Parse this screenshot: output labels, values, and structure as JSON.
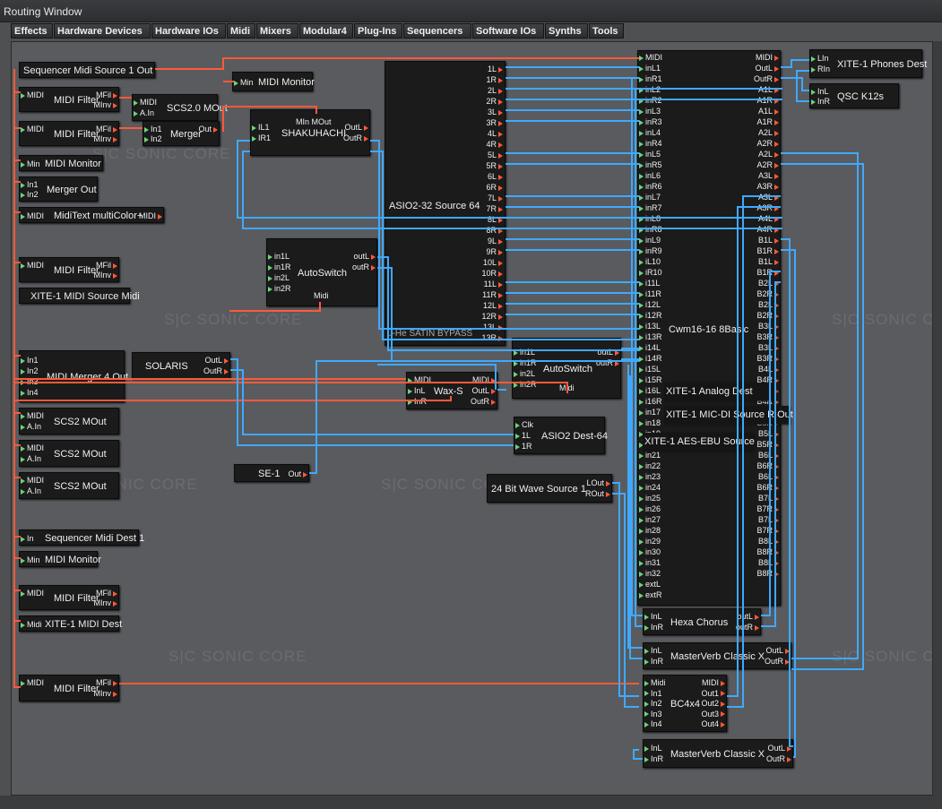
{
  "window_title": "Routing Window",
  "watermark": "SONIC CORE",
  "watermark_logo": "S|C",
  "tabs": [
    "Effects",
    "Hardware Devices",
    "Hardware IOs",
    "Midi",
    "Mixers",
    "Modular4",
    "Plug-Ins",
    "Sequencers",
    "Software IOs",
    "Synths",
    "Tools"
  ],
  "colors": {
    "midi_wire": "#ff5a38",
    "audio_wire": "#3fa9ff",
    "input_port": "#6ad47a",
    "output_port": "#ff5a38",
    "canvas": "#595b5f",
    "module": "#1b1b1b"
  },
  "modules": {
    "seq_src": {
      "name": "Sequencer Midi Source 1 Out"
    },
    "filter1": {
      "name": "MIDI Filter",
      "ins": [
        "MIDI"
      ],
      "outs": [
        "MFil",
        "MInv"
      ]
    },
    "filter2": {
      "name": "MIDI Filter",
      "ins": [
        "MIDI"
      ],
      "outs": [
        "MFil",
        "MInv"
      ]
    },
    "scs1": {
      "name": "SCS2.0 MOut",
      "ins": [
        "MIDI",
        "A.In"
      ]
    },
    "merger1": {
      "name": "Merger",
      "ins": [
        "In1",
        "In2"
      ],
      "outs": [
        "Out"
      ]
    },
    "mon1": {
      "name": "MIDI Monitor",
      "ins": [
        "Min"
      ]
    },
    "merger2": {
      "name": "Merger Out",
      "ins": [
        "In1",
        "In2"
      ]
    },
    "miditext": {
      "name": "MidiText multiColor+",
      "ins": [
        "MIDI"
      ],
      "outs": [
        "MIDI"
      ]
    },
    "filter3": {
      "name": "MIDI Filter",
      "ins": [
        "MIDI"
      ],
      "outs": [
        "MFil",
        "MInv"
      ]
    },
    "xite_src": {
      "name": "XITE-1 MIDI Source Midi"
    },
    "merger4": {
      "name": "MIDI Merger 4 Out",
      "ins": [
        "In1",
        "In2",
        "In3",
        "In4"
      ]
    },
    "scs2": {
      "name": "SCS2 MOut",
      "ins": [
        "MIDI",
        "A.In"
      ]
    },
    "scs3": {
      "name": "SCS2 MOut",
      "ins": [
        "MIDI",
        "A.In"
      ]
    },
    "scs4": {
      "name": "SCS2 MOut",
      "ins": [
        "MIDI",
        "A.In"
      ]
    },
    "seq_dest": {
      "name": "Sequencer Midi Dest 1",
      "ins": [
        "In"
      ]
    },
    "mon3": {
      "name": "MIDI Monitor",
      "ins": [
        "Min"
      ]
    },
    "filter4": {
      "name": "MIDI Filter",
      "ins": [
        "MIDI"
      ],
      "outs": [
        "MFil",
        "MInv"
      ]
    },
    "xite_dest": {
      "name": "XITE-1 MIDI Dest",
      "ins": [
        "Midi"
      ]
    },
    "filter5": {
      "name": "MIDI Filter",
      "ins": [
        "MIDI"
      ],
      "outs": [
        "MFil",
        "MInv"
      ]
    },
    "mon2": {
      "name": "MIDI Monitor",
      "ins": [
        "Min"
      ]
    },
    "shaku": {
      "name": "SHAKUHACHI",
      "ins": [
        "IL1",
        "IR1"
      ],
      "outs": [
        "OutL",
        "OutR"
      ],
      "top": "MIn MOut"
    },
    "autosw1": {
      "name": "AutoSwitch",
      "ins": [
        "in1L",
        "in1R",
        "in2L",
        "in2R"
      ],
      "outs": [
        "outL",
        "outR"
      ],
      "bottom": "Midi"
    },
    "solaris": {
      "name": "SOLARIS",
      "outs": [
        "OutL",
        "OutR"
      ]
    },
    "se1": {
      "name": "SE-1",
      "outs": [
        "Out"
      ]
    },
    "asio_src": {
      "name": "ASIO2-32 Source 64",
      "outs": [
        "1L",
        "1R",
        "2L",
        "2R",
        "3L",
        "3R",
        "4L",
        "4R",
        "5L",
        "5R",
        "6L",
        "6R",
        "7L",
        "7R",
        "8L",
        "8R",
        "9L",
        "9R",
        "10L",
        "10R",
        "11L",
        "11R",
        "12L",
        "12R",
        "13L",
        "13R"
      ],
      "footer": "u-He SATIN BYPASS"
    },
    "autosw2": {
      "name": "AutoSwitch",
      "ins": [
        "in1L",
        "in1R",
        "in2L",
        "in2R"
      ],
      "outs": [
        "outL",
        "outR"
      ],
      "bottom": "Midi"
    },
    "waxs": {
      "name": "Wax-S",
      "ins": [
        "MIDI",
        "InL",
        "InR"
      ],
      "outs": [
        "MIDI",
        "OutL",
        "OutR"
      ]
    },
    "asio_dest": {
      "name": "ASIO2 Dest-64",
      "ins": [
        "Clk",
        "1L",
        "1R"
      ]
    },
    "wave24": {
      "name": "24 Bit Wave Source 1",
      "outs": [
        "LOut",
        "ROut"
      ]
    },
    "cwm": {
      "name": "Cwm16-16 8Basic",
      "ins": [
        "MIDI",
        "inL1",
        "inR1",
        "inL2",
        "inR2",
        "inL3",
        "inR3",
        "inL4",
        "inR4",
        "inL5",
        "inR5",
        "inL6",
        "inR6",
        "inL7",
        "inR7",
        "inL8",
        "inR8",
        "inL9",
        "inR9",
        "iL10",
        "iR10",
        "i11L",
        "i11R",
        "i12L",
        "i12R",
        "i13L",
        "i13R",
        "i14L",
        "i14R",
        "i15L",
        "i15R",
        "i16L",
        "i16R",
        "in17",
        "in18",
        "in19",
        "in20",
        "in21",
        "in22",
        "in23",
        "in24",
        "in25",
        "in26",
        "in27",
        "in28",
        "in29",
        "in30",
        "in31",
        "in32",
        "extL",
        "extR"
      ],
      "outs": [
        "MIDI",
        "OutL",
        "OutR",
        "A1L",
        "A1R",
        "A1L",
        "A1R",
        "A2L",
        "A2R",
        "A2L",
        "A2R",
        "A3L",
        "A3R",
        "A3L",
        "A3R",
        "A4L",
        "A4R",
        "B1L",
        "B1R",
        "B1L",
        "B1R",
        "B2L",
        "B2R",
        "B2L",
        "B2R",
        "B3L",
        "B3R",
        "B3L",
        "B3R",
        "B4L",
        "B4R",
        "B4L",
        "B4R",
        "B5L",
        "B5R",
        "B5L",
        "B5R",
        "B6L",
        "B6R",
        "B6L",
        "B6R",
        "B7L",
        "B7R",
        "B7L",
        "B7R",
        "B8L",
        "B8R",
        "B8L",
        "B8R"
      ]
    },
    "xite_analog": {
      "name": "XITE-1 Analog Dest"
    },
    "xite_micdi": {
      "name": "XITE-1 MIC-DI Source R Out"
    },
    "xite_aes": {
      "name": "XITE-1 AES-EBU Source"
    },
    "phones": {
      "name": "XITE-1 Phones Dest",
      "ins": [
        "LIn",
        "RIn"
      ]
    },
    "qsc": {
      "name": "QSC K12s",
      "ins": [
        "InL",
        "InR"
      ]
    },
    "hexa": {
      "name": "Hexa Chorus",
      "ins": [
        "InL",
        "InR"
      ],
      "outs": [
        "outL",
        "outR"
      ]
    },
    "mverb1": {
      "name": "MasterVerb Classic X",
      "ins": [
        "InL",
        "InR"
      ],
      "outs": [
        "OutL",
        "OutR"
      ]
    },
    "bc4x4": {
      "name": "BC4x4",
      "ins": [
        "Midi",
        "In1",
        "In2",
        "In3",
        "In4"
      ],
      "outs": [
        "MIDI",
        "Out1",
        "Out2",
        "Out3",
        "Out4"
      ]
    },
    "mverb2": {
      "name": "MasterVerb Classic X",
      "ins": [
        "InL",
        "InR"
      ],
      "outs": [
        "OutL",
        "OutR"
      ]
    }
  }
}
